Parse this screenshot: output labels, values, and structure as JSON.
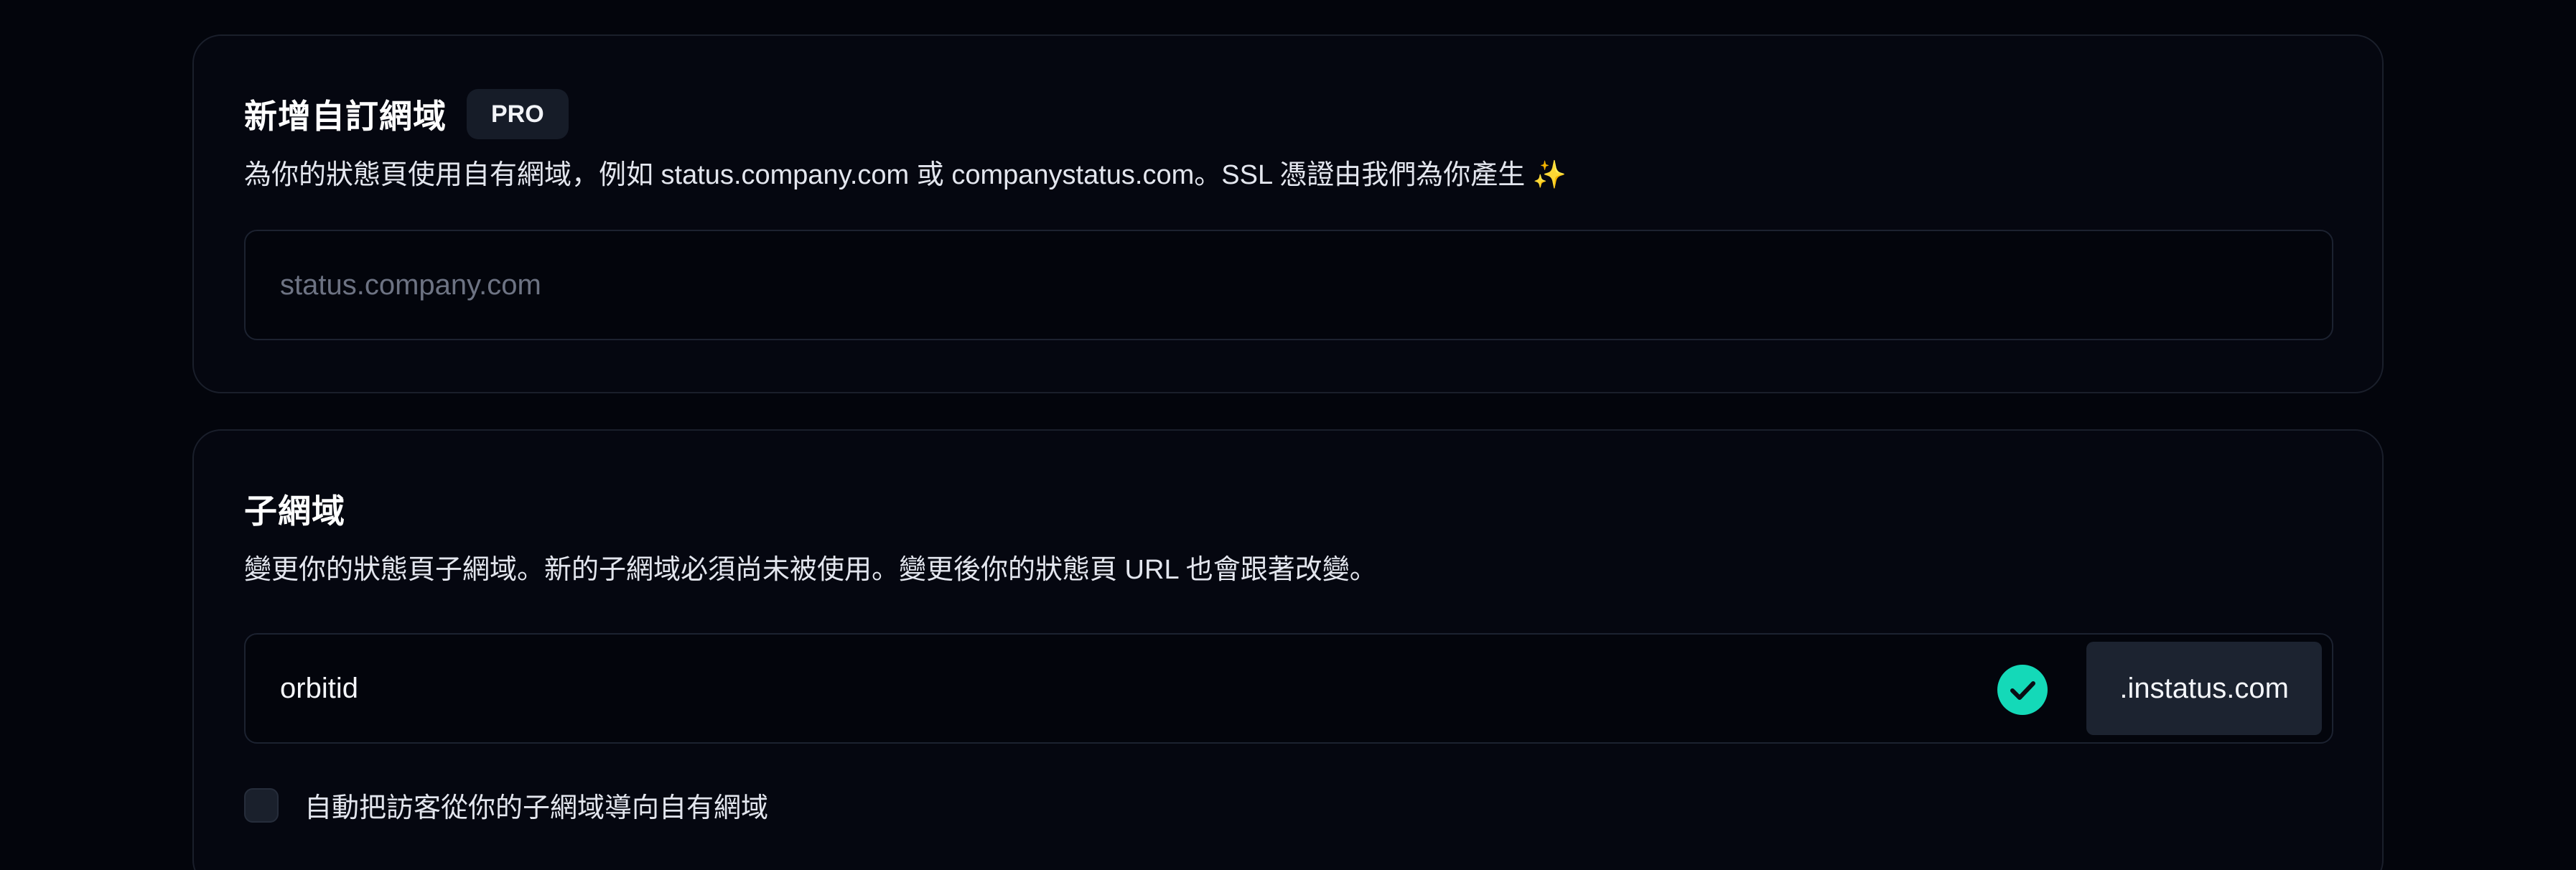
{
  "custom_domain": {
    "title": "新增自訂網域",
    "badge": "PRO",
    "description": "為你的狀態頁使用自有網域，例如 status.company.com 或 companystatus.com。SSL 憑證由我們為你產生",
    "sparkle": "✨",
    "input_value": "",
    "input_placeholder": "status.company.com"
  },
  "subdomain": {
    "title": "子網域",
    "description": "變更你的狀態頁子網域。新的子網域必須尚未被使用。變更後你的狀態頁 URL 也會跟著改變。",
    "input_value": "orbitid",
    "validation_status": "valid",
    "suffix": ".instatus.com",
    "redirect_checkbox_label": "自動把訪客從你的子網域導向自有網域",
    "redirect_checked": false
  },
  "colors": {
    "background": "#03050c",
    "card_border": "#1a1f2b",
    "accent_check": "#14d9b8",
    "badge_bg": "#161c28"
  },
  "icons": {
    "validation": "check-circle-icon"
  }
}
